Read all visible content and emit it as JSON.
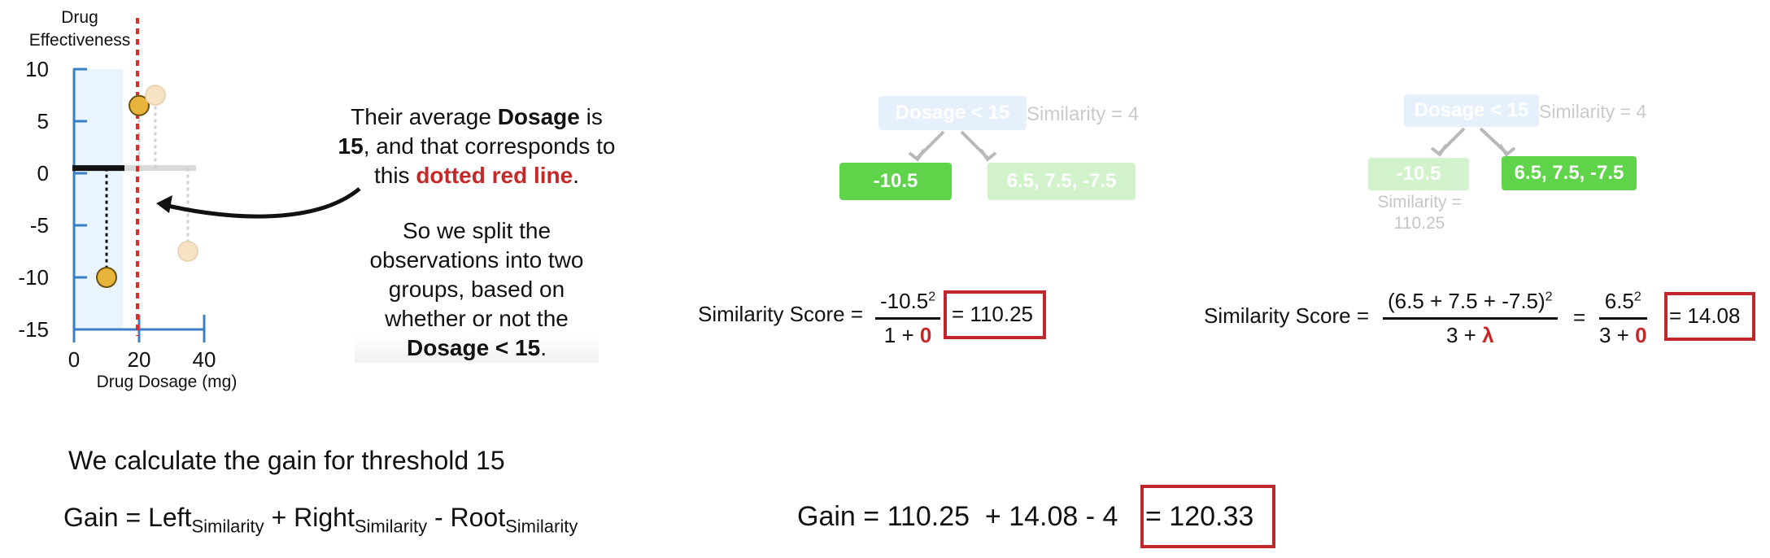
{
  "left_plot": {
    "y_title_line1": "Drug",
    "y_title_line2": "Effectiveness",
    "x_title": "Drug Dosage (mg)",
    "y_ticks": [
      "10",
      "5",
      "0",
      "-5",
      "-10",
      "-15"
    ],
    "x_ticks": [
      "0",
      "20",
      "40"
    ],
    "threshold_color": "#d32f2f",
    "point_gold": "#e9b43b",
    "point_faded": "#f7e2c4",
    "chart_data": {
      "type": "scatter",
      "xlabel": "Drug Dosage (mg)",
      "ylabel": "Drug Effectiveness",
      "xlim": [
        0,
        40
      ],
      "ylim": [
        -15,
        10
      ],
      "points": [
        {
          "x": 10,
          "y": -10,
          "group": "left"
        },
        {
          "x": 20,
          "y": 6.5,
          "group": "right"
        },
        {
          "x": 25,
          "y": 7.5,
          "group": "right"
        },
        {
          "x": 35,
          "y": -7.5,
          "group": "right"
        }
      ],
      "threshold_x": 15,
      "left_prediction": 0.5,
      "right_prediction": 0.5
    }
  },
  "callout": {
    "p1_a": "Their average ",
    "p1_b": "Dosage",
    "p1_c": " is",
    "p1_d": "15",
    "p1_e": ", and that corresponds to",
    "p1_f": "this ",
    "p1_g": "dotted red line",
    "p1_h": ".",
    "p2_l1": "So we split the",
    "p2_l2": "observations into two",
    "p2_l3": "groups, based on",
    "p2_l4": "whether or not the",
    "p2_l5": "Dosage < 15",
    "p2_l6": "."
  },
  "tree_left": {
    "root_label": "Dosage < 15",
    "root_similarity": "Similarity = 4",
    "left_leaf": "-10.5",
    "right_leaf": "6.5, 7.5, -7.5"
  },
  "tree_right": {
    "root_label": "Dosage < 15",
    "root_similarity": "Similarity = 4",
    "left_leaf": "-10.5",
    "left_similarity_l1": "Similarity =",
    "left_similarity_l2": "110.25",
    "right_leaf": "6.5, 7.5, -7.5"
  },
  "formula_left": {
    "label": "Similarity Score =",
    "num": "-10.5",
    "num_exp": "2",
    "den_a": "1 + ",
    "den_b": "0",
    "result": "= 110.25"
  },
  "formula_right": {
    "label": "Similarity Score =",
    "num1": "(6.5 + 7.5 + -7.5)",
    "num1_exp": "2",
    "den1_a": "3 + ",
    "den1_b": "λ",
    "eq": "=",
    "num2": "6.5",
    "num2_exp": "2",
    "den2_a": "3 + ",
    "den2_b": "0",
    "result": "= 14.08"
  },
  "gain": {
    "heading": "We calculate the gain for threshold 15",
    "prefix": "Gain = ",
    "left": "Left",
    "plus": " + ",
    "right": "Right",
    "minus": " - ",
    "root": "Root",
    "sub": "Similarity",
    "calc": "Gain = 110.25  + 14.08 - 4 ",
    "result": "= 120.33"
  }
}
